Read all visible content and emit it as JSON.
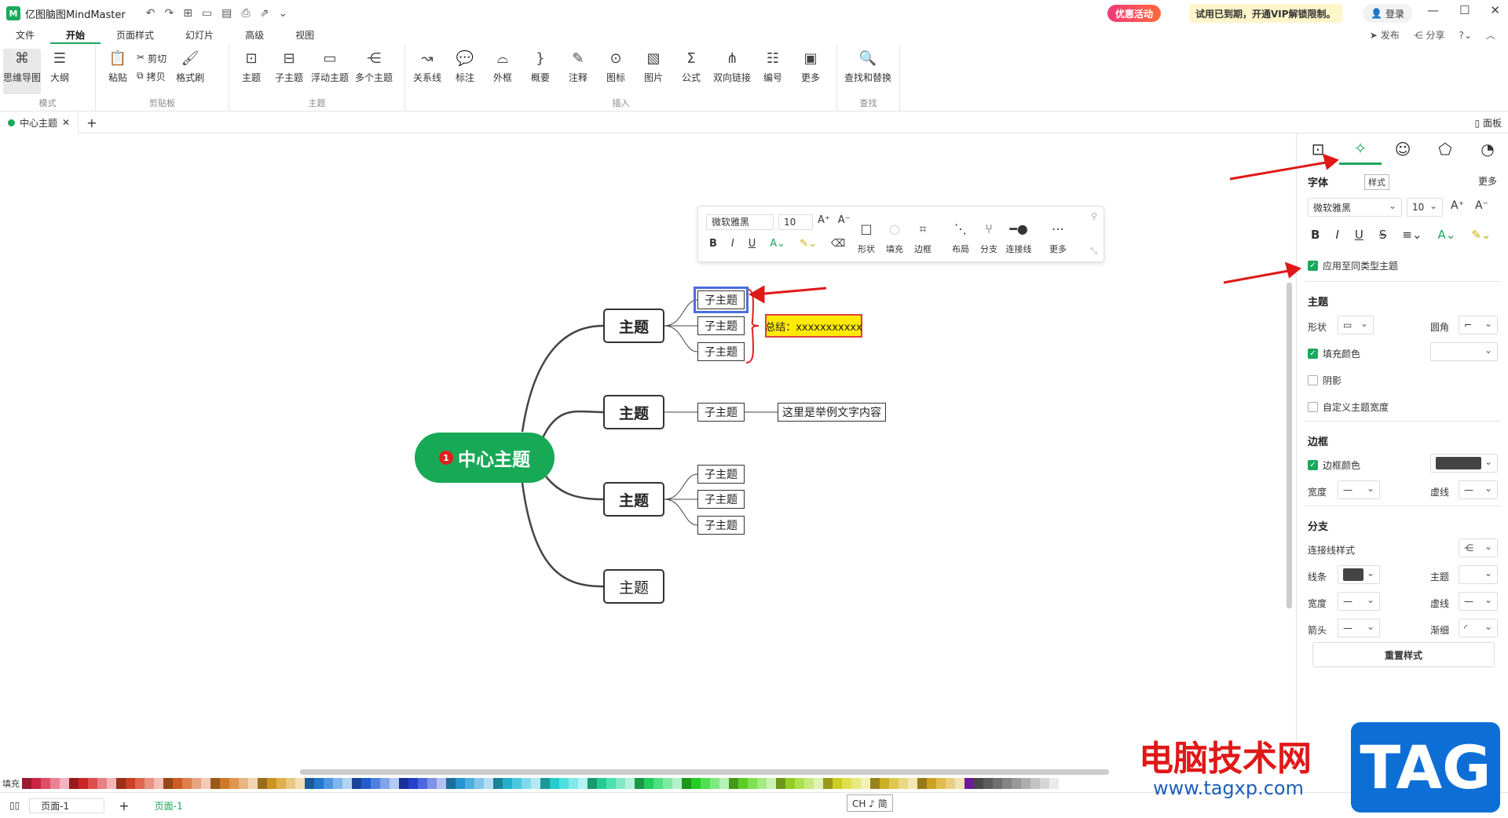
{
  "app": {
    "title": "亿图脑图MindMaster",
    "logo": "M"
  },
  "topbar": {
    "promo": "优惠活动",
    "vip": "试用已到期，开通VIP解锁限制。",
    "login": "登录"
  },
  "menu": {
    "items": [
      "文件",
      "开始",
      "页面样式",
      "幻灯片",
      "高级",
      "视图"
    ],
    "active_index": 1,
    "publish": "发布",
    "share": "分享"
  },
  "ribbon": {
    "groups": [
      {
        "label": "模式",
        "buttons": [
          "思维导图",
          "大纲"
        ]
      },
      {
        "label": "剪贴板",
        "buttons": [
          "粘贴",
          "格式刷"
        ],
        "small": [
          "剪切",
          "拷贝"
        ]
      },
      {
        "label": "主题",
        "buttons": [
          "主题",
          "子主题",
          "浮动主题",
          "多个主题"
        ]
      },
      {
        "label": "插入",
        "buttons": [
          "关系线",
          "标注",
          "外框",
          "概要",
          "注释",
          "图标",
          "图片",
          "公式",
          "双向链接",
          "编号",
          "更多"
        ]
      },
      {
        "label": "查找",
        "buttons": [
          "查找和替换"
        ]
      }
    ]
  },
  "tabs": {
    "doc": "中心主题",
    "panel_toggle": "面板"
  },
  "canvas": {
    "center": {
      "text": "中心主题",
      "badge": "1"
    },
    "topics": [
      "主题",
      "主题",
      "主题",
      "主题"
    ],
    "subtopic": "子主题",
    "note": "这里是举例文字内容",
    "summary": "总结：xxxxxxxxxxx"
  },
  "float_toolbar": {
    "font": "微软雅黑",
    "size": "10",
    "tools": [
      "形状",
      "填充",
      "边框",
      "布局",
      "分支",
      "连接线",
      "更多"
    ]
  },
  "panel": {
    "tooltip": "样式",
    "font_title": "字体",
    "more": "更多",
    "font": "微软雅黑",
    "size": "10",
    "apply_same": "应用至同类型主题",
    "topic_title": "主题",
    "shape": "形状",
    "corner": "圆角",
    "fill_color": "填充颜色",
    "shadow": "阴影",
    "custom_width": "自定义主题宽度",
    "border_title": "边框",
    "border_color": "边框颜色",
    "width": "宽度",
    "dash": "虚线",
    "branch_title": "分支",
    "line_style": "连接线样式",
    "line": "线条",
    "branch_topic": "主题",
    "branch_width": "宽度",
    "branch_dash": "虚线",
    "arrow": "箭头",
    "taper": "渐细",
    "reset": "重置样式"
  },
  "colors": {
    "accent": "#1aa85b",
    "summary_fill": "#ffea00",
    "arrow": "#e01818"
  },
  "bottombar": {
    "fill_label": "填充",
    "page_select": "页面-1",
    "page_tab": "页面-1",
    "ime": "CH ♪ 简"
  },
  "watermark": {
    "text": "电脑技术网",
    "url": "www.tagxp.com",
    "tag": "TAG"
  }
}
